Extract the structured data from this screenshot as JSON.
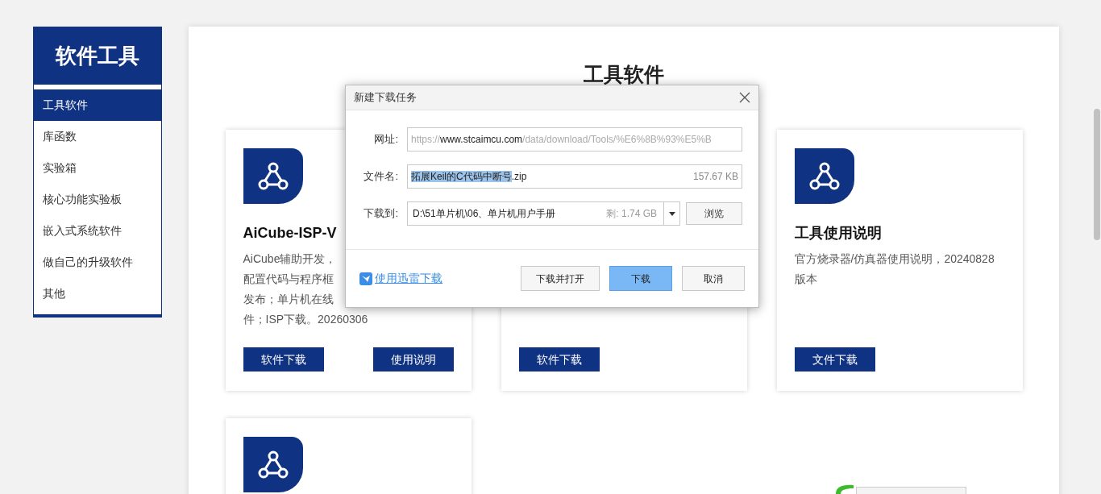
{
  "sidebar": {
    "title": "软件工具",
    "items": [
      {
        "label": "工具软件",
        "selected": true
      },
      {
        "label": "库函数",
        "selected": false
      },
      {
        "label": "实验箱",
        "selected": false
      },
      {
        "label": "核心功能实验板",
        "selected": false
      },
      {
        "label": "嵌入式系统软件",
        "selected": false
      },
      {
        "label": "做自己的升级软件",
        "selected": false
      },
      {
        "label": "其他",
        "selected": false
      }
    ]
  },
  "main": {
    "heading": "工具软件",
    "cards": [
      {
        "kind": "tool",
        "title": "AiCube-ISP-V",
        "description_lines": [
          "AiCube辅助开发，",
          "配置代码与程序框",
          "发布；单片机在线",
          "件；ISP下载。20260306"
        ],
        "buttons": [
          "软件下载",
          "使用说明"
        ]
      },
      {
        "kind": "tool",
        "buttons": [
          "软件下载"
        ]
      },
      {
        "kind": "tool",
        "title": "工具使用说明",
        "description_lines": [
          "官方烧录器/仿真器使用说明，20240828",
          "版本"
        ],
        "buttons": [
          "文件下载"
        ]
      },
      {
        "kind": "tool"
      }
    ]
  },
  "dialog": {
    "title": "新建下载任务",
    "url": {
      "label": "网址:",
      "prefix": "https://",
      "host": "www.stcaimcu.com",
      "path": "/data/download/Tools/%E6%8B%93%E5%B"
    },
    "filename": {
      "label": "文件名:",
      "selected_part": "拓展Keil的C代码中断号",
      "rest": ".zip",
      "size": "157.67 KB"
    },
    "save_to": {
      "label": "下载到:",
      "path": "D:\\51单片机\\06、单片机用户手册",
      "free": "剩: 1.74 GB",
      "browse": "浏览"
    },
    "thunder_link": "使用迅雷下载",
    "buttons": [
      {
        "label": "下载并打开",
        "primary": false
      },
      {
        "label": "下载",
        "primary": true
      },
      {
        "label": "取消",
        "primary": false
      }
    ]
  }
}
